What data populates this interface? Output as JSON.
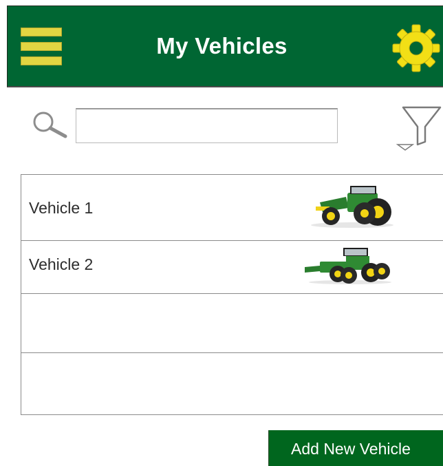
{
  "header": {
    "title": "My Vehicles",
    "menu_icon": "hamburger-menu-icon",
    "settings_icon": "gear-icon"
  },
  "search": {
    "value": "",
    "placeholder": "",
    "search_icon": "magnifier-icon",
    "filter_icon": "funnel-filter-icon"
  },
  "vehicles": [
    {
      "label": "Vehicle 1",
      "image": "green-tractor-image"
    },
    {
      "label": "Vehicle 2",
      "image": "green-articulated-tractor-image"
    },
    {
      "label": ""
    },
    {
      "label": ""
    }
  ],
  "actions": {
    "add_label": "Add New Vehicle"
  },
  "colors": {
    "header_green": "#006633",
    "menu_yellow": "#E2D542",
    "gear_yellow": "#F2DF16",
    "button_green": "#00661E"
  }
}
